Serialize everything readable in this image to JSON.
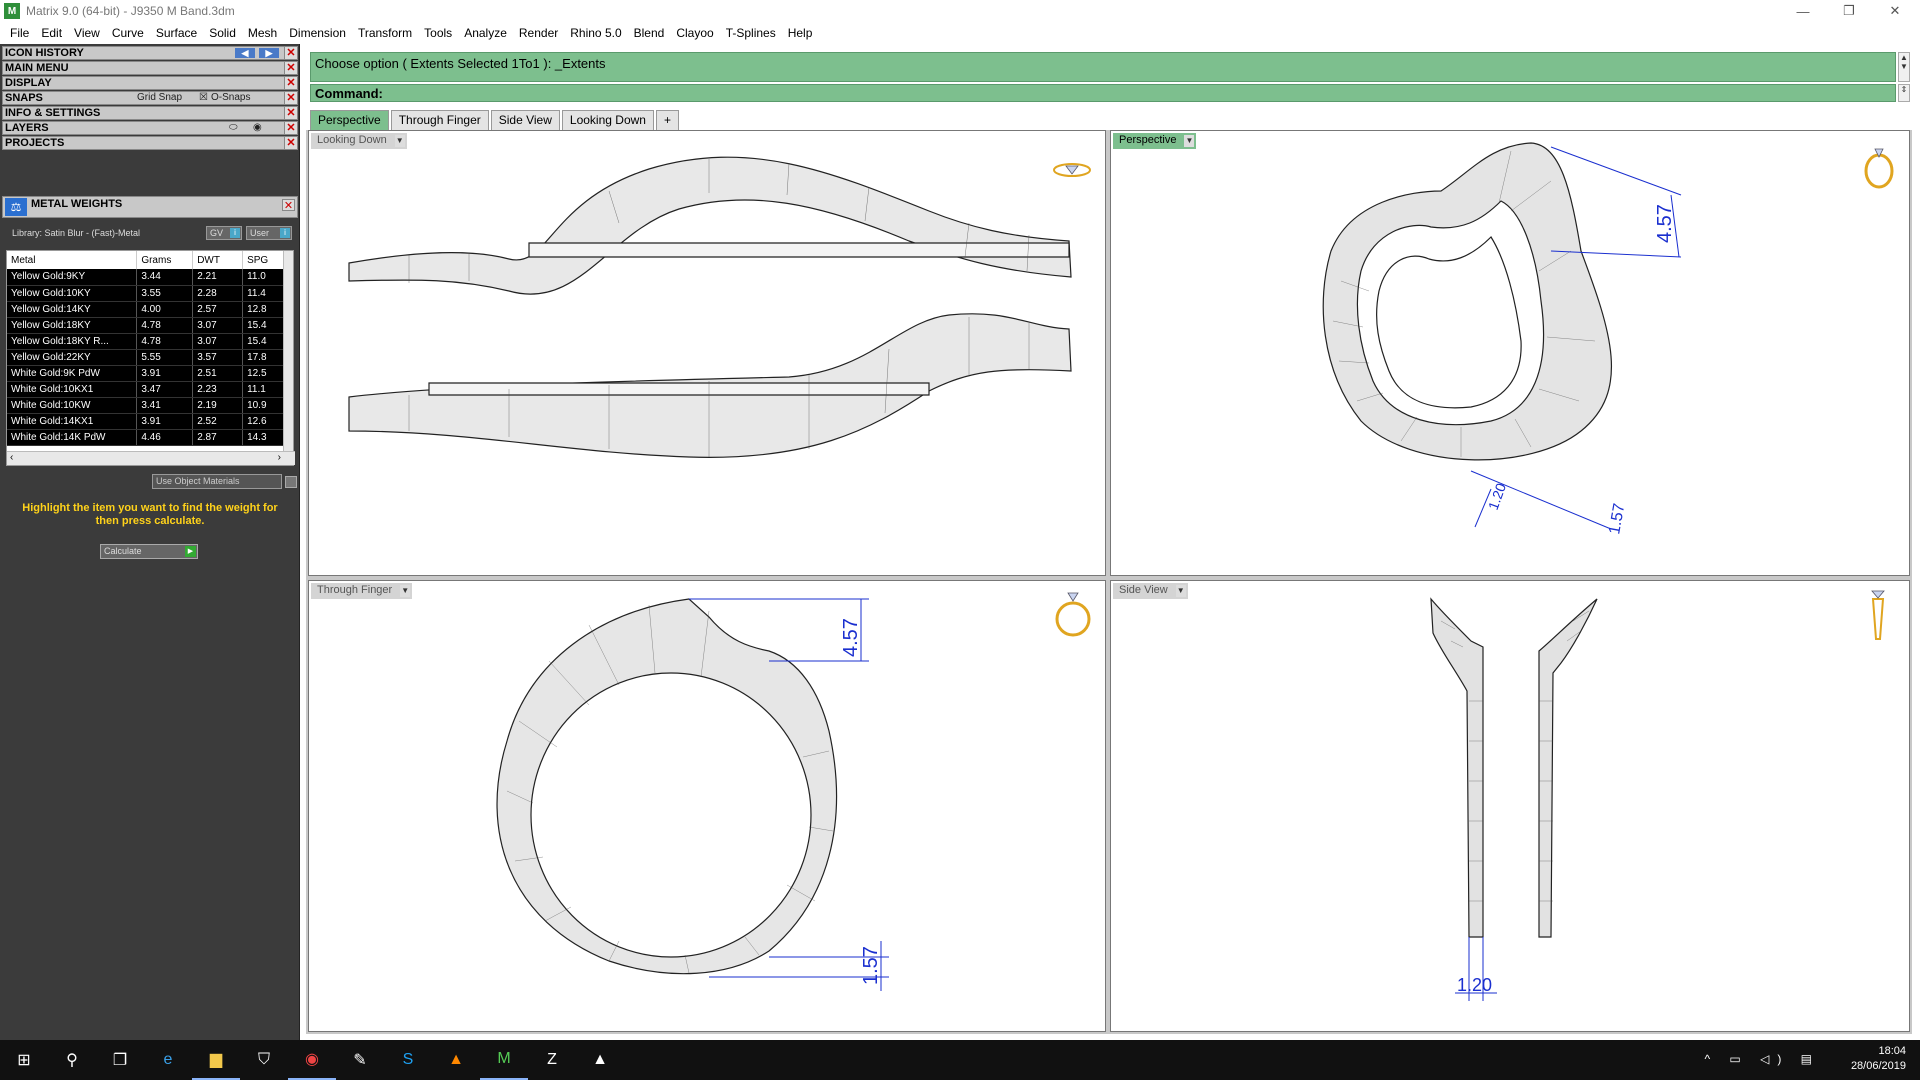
{
  "window": {
    "title": "Matrix 9.0 (64-bit) - J9350 M Band.3dm",
    "app_icon": "matrix-logo-icon",
    "controls": [
      "—",
      "❐",
      "✕"
    ]
  },
  "menu": [
    "File",
    "Edit",
    "View",
    "Curve",
    "Surface",
    "Solid",
    "Mesh",
    "Dimension",
    "Transform",
    "Tools",
    "Analyze",
    "Render",
    "Rhino 5.0",
    "Blend",
    "Clayoo",
    "T-Splines",
    "Help"
  ],
  "panel": {
    "sections": {
      "icon_history": "ICON HISTORY",
      "main_menu": "MAIN MENU",
      "display": "DISPLAY",
      "snaps": "SNAPS",
      "info_settings": "INFO & SETTINGS",
      "layers": "LAYERS",
      "projects": "PROJECTS"
    },
    "close_glyph": "✕",
    "grid_snap": "Grid Snap",
    "o_snaps": "O-Snaps",
    "metal_weights": {
      "title": "METAL WEIGHTS",
      "library": "Library: Satin Blur - (Fast)-Metal",
      "gv_btn": "GV",
      "user_btn": "User",
      "columns": [
        "Metal",
        "Grams",
        "DWT",
        "SPG"
      ],
      "rows": [
        [
          "Yellow Gold:9KY",
          "3.44",
          "2.21",
          "11.0"
        ],
        [
          "Yellow Gold:10KY",
          "3.55",
          "2.28",
          "11.4"
        ],
        [
          "Yellow Gold:14KY",
          "4.00",
          "2.57",
          "12.8"
        ],
        [
          "Yellow Gold:18KY",
          "4.78",
          "3.07",
          "15.4"
        ],
        [
          "Yellow Gold:18KY R...",
          "4.78",
          "3.07",
          "15.4"
        ],
        [
          "Yellow Gold:22KY",
          "5.55",
          "3.57",
          "17.8"
        ],
        [
          "White Gold:9K PdW",
          "3.91",
          "2.51",
          "12.5"
        ],
        [
          "White Gold:10KX1",
          "3.47",
          "2.23",
          "11.1"
        ],
        [
          "White Gold:10KW",
          "3.41",
          "2.19",
          "10.9"
        ],
        [
          "White Gold:14KX1",
          "3.91",
          "2.52",
          "12.6"
        ],
        [
          "White Gold:14K PdW",
          "4.46",
          "2.87",
          "14.3"
        ]
      ],
      "use_object_materials": "Use Object Materials",
      "hint": "Highlight the item you want to find the weight for then press calculate.",
      "calculate": "Calculate"
    }
  },
  "command": {
    "prompt": "Choose option ( Extents  Selected  1To1 ): _Extents",
    "label": "Command:"
  },
  "tabs": [
    "Perspective",
    "Through Finger",
    "Side View",
    "Looking Down",
    "+"
  ],
  "viewports": {
    "top_left": {
      "label": "Looking Down",
      "icon": "ring-top-icon"
    },
    "top_right": {
      "label": "Perspective",
      "icon": "ring-perspective-icon",
      "dims": [
        "4.57",
        "1.20",
        "1.57"
      ]
    },
    "bottom_left": {
      "label": "Through Finger",
      "icon": "ring-front-icon",
      "dims": [
        "4.57",
        "1.57"
      ]
    },
    "bottom_right": {
      "label": "Side View",
      "icon": "ring-side-icon",
      "dims": [
        "1.20"
      ]
    }
  },
  "taskbar": {
    "time": "18:04",
    "date": "28/06/2019",
    "apps": [
      "start-icon",
      "search-icon",
      "task-view-icon",
      "edge-icon",
      "file-explorer-icon",
      "store-icon",
      "chrome-icon",
      "paint-icon",
      "skype-icon",
      "vlc-icon",
      "matrix-icon",
      "zbrush-icon",
      "photos-icon"
    ]
  },
  "colors": {
    "command_bg": "#7dbf8e",
    "panel_bg": "#3b3b3b",
    "dimension": "#1a2fcf",
    "hint": "#ffd21a"
  }
}
